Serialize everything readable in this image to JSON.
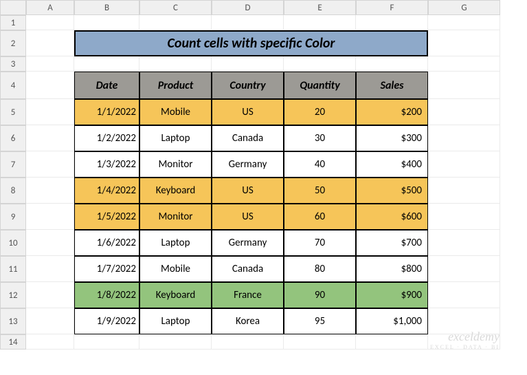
{
  "columns": [
    "A",
    "B",
    "C",
    "D",
    "E",
    "F",
    "G"
  ],
  "rows": [
    "1",
    "2",
    "3",
    "4",
    "5",
    "6",
    "7",
    "8",
    "9",
    "10",
    "11",
    "12",
    "13",
    "14"
  ],
  "title": "Count cells with specific Color",
  "headers": [
    "Date",
    "Product",
    "Country",
    "Quantity",
    "Sales"
  ],
  "data": [
    {
      "date": "1/1/2022",
      "product": "Mobile",
      "country": "US",
      "quantity": "20",
      "sales": "$200",
      "fill": "yellow"
    },
    {
      "date": "1/2/2022",
      "product": "Laptop",
      "country": "Canada",
      "quantity": "30",
      "sales": "$300",
      "fill": "white"
    },
    {
      "date": "1/3/2022",
      "product": "Monitor",
      "country": "Germany",
      "quantity": "40",
      "sales": "$400",
      "fill": "white"
    },
    {
      "date": "1/4/2022",
      "product": "Keyboard",
      "country": "US",
      "quantity": "50",
      "sales": "$500",
      "fill": "yellow"
    },
    {
      "date": "1/5/2022",
      "product": "Monitor",
      "country": "US",
      "quantity": "60",
      "sales": "$600",
      "fill": "yellow"
    },
    {
      "date": "1/6/2022",
      "product": "Laptop",
      "country": "Germany",
      "quantity": "70",
      "sales": "$700",
      "fill": "white"
    },
    {
      "date": "1/7/2022",
      "product": "Mobile",
      "country": "Canada",
      "quantity": "80",
      "sales": "$800",
      "fill": "white"
    },
    {
      "date": "1/8/2022",
      "product": "Keyboard",
      "country": "France",
      "quantity": "90",
      "sales": "$900",
      "fill": "green"
    },
    {
      "date": "1/9/2022",
      "product": "Laptop",
      "country": "Korea",
      "quantity": "95",
      "sales": "$1,000",
      "fill": "white"
    }
  ],
  "watermark": {
    "line1": "exceldemy",
    "line2": "EXCEL · DATA · BI"
  },
  "chart_data": {
    "type": "table",
    "title": "Count cells with specific Color",
    "columns": [
      "Date",
      "Product",
      "Country",
      "Quantity",
      "Sales"
    ],
    "rows": [
      [
        "1/1/2022",
        "Mobile",
        "US",
        20,
        200
      ],
      [
        "1/2/2022",
        "Laptop",
        "Canada",
        30,
        300
      ],
      [
        "1/3/2022",
        "Monitor",
        "Germany",
        40,
        400
      ],
      [
        "1/4/2022",
        "Keyboard",
        "US",
        50,
        500
      ],
      [
        "1/5/2022",
        "Monitor",
        "US",
        60,
        600
      ],
      [
        "1/6/2022",
        "Laptop",
        "Germany",
        70,
        700
      ],
      [
        "1/7/2022",
        "Mobile",
        "Canada",
        80,
        800
      ],
      [
        "1/8/2022",
        "Keyboard",
        "France",
        90,
        900
      ],
      [
        "1/9/2022",
        "Laptop",
        "Korea",
        95,
        1000
      ]
    ],
    "row_fill": [
      "yellow",
      "white",
      "white",
      "yellow",
      "yellow",
      "white",
      "white",
      "green",
      "white"
    ]
  }
}
